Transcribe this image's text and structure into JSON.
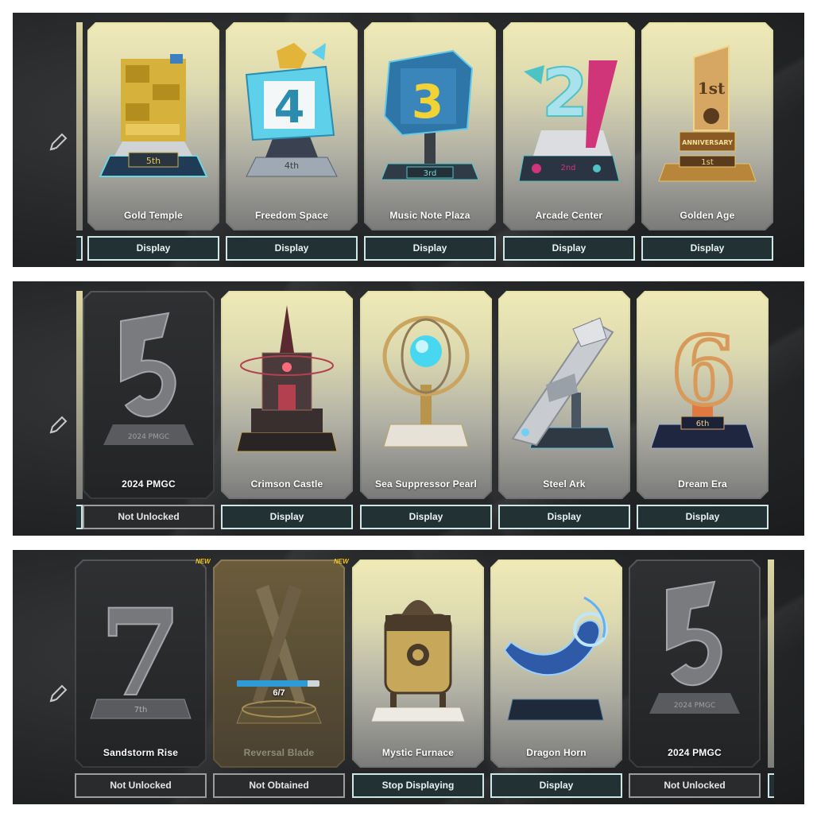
{
  "panels": [
    {
      "cards": [
        {
          "title": "Gold Temple",
          "button": "Display",
          "plaque": "5th"
        },
        {
          "title": "Freedom Space",
          "button": "Display",
          "plaque": "4th",
          "digit": "4"
        },
        {
          "title": "Music Note Plaza",
          "button": "Display",
          "plaque": "3rd",
          "digit": "3"
        },
        {
          "title": "Arcade Center",
          "button": "Display",
          "plaque": "2nd",
          "digit": "2"
        },
        {
          "title": "Golden Age",
          "button": "Display",
          "plaque": "1st",
          "banner": "ANNIVERSARY"
        }
      ]
    },
    {
      "cards": [
        {
          "title": "2024 PMGC",
          "button": "Not Unlocked",
          "plaque": "2024 PMGC"
        },
        {
          "title": "Crimson Castle",
          "button": "Display"
        },
        {
          "title": "Sea Suppressor Pearl",
          "button": "Display"
        },
        {
          "title": "Steel Ark",
          "button": "Display"
        },
        {
          "title": "Dream Era",
          "button": "Display",
          "plaque": "6th",
          "digit": "6"
        }
      ]
    },
    {
      "cards": [
        {
          "title": "Sandstorm Rise",
          "button": "Not Unlocked",
          "plaque": "7th",
          "digit": "7",
          "badge": "NEW"
        },
        {
          "title": "Reversal Blade",
          "button": "Not Obtained",
          "badge": "NEW",
          "progress_text": "6/7",
          "progress": 0.86
        },
        {
          "title": "Mystic Furnace",
          "button": "Stop Displaying"
        },
        {
          "title": "Dragon Horn",
          "button": "Display"
        },
        {
          "title": "2024 PMGC",
          "button": "Not Unlocked",
          "plaque": "2024 PMGC"
        }
      ]
    }
  ],
  "colors": {
    "card_gold_top": "#efeab6",
    "button_bg": "#223234",
    "button_border": "#cfe6e6",
    "badge_new": "#f4c51a",
    "progress": "#2f9bd6"
  },
  "icons": {
    "edit": "pencil-icon"
  }
}
